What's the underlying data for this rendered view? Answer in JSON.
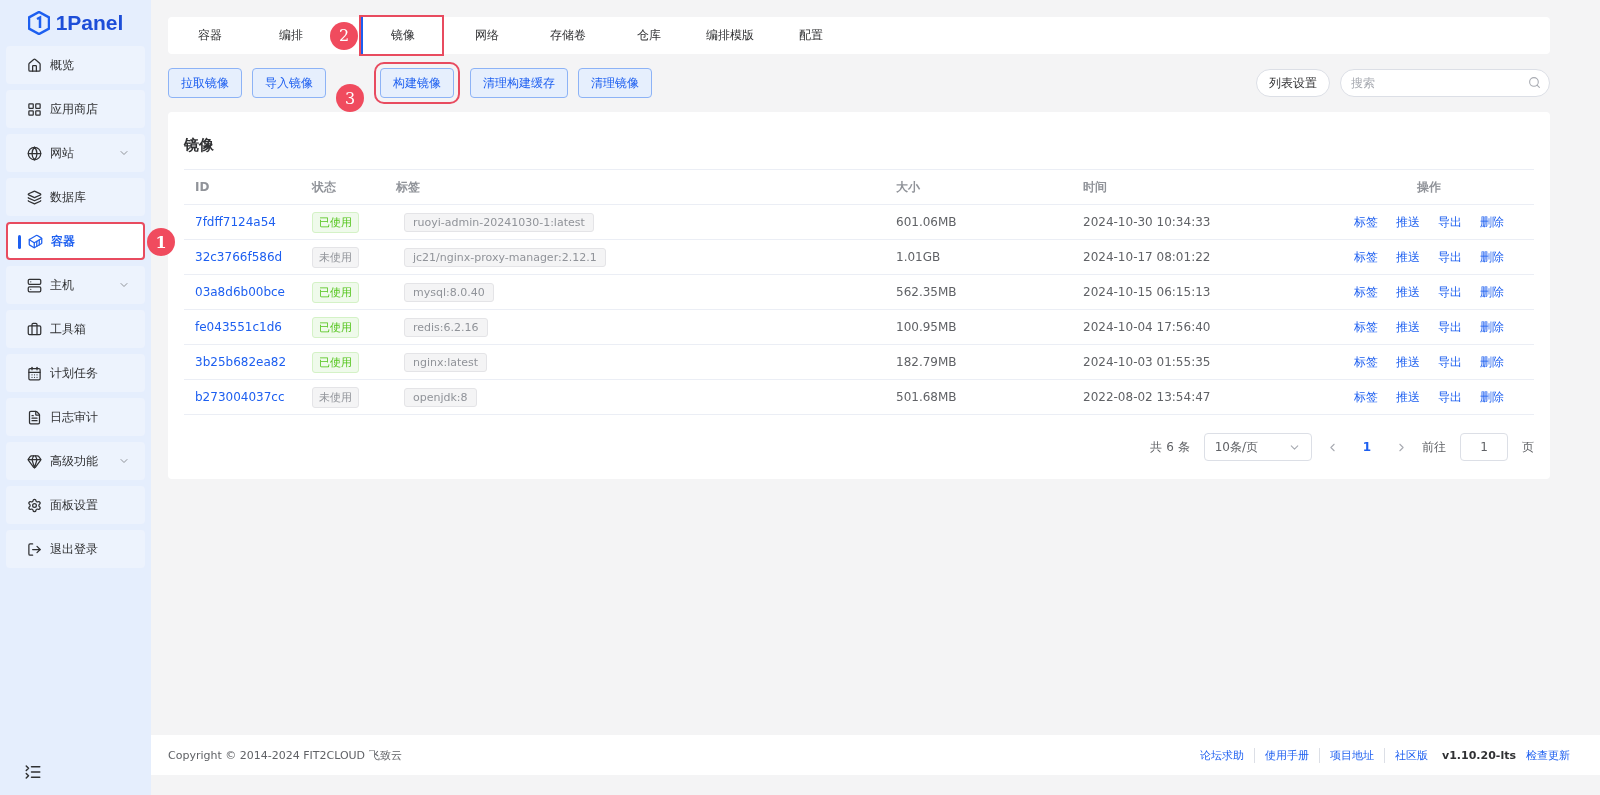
{
  "logo": "1Panel",
  "sidebar": {
    "items": [
      {
        "label": "概览",
        "selected": false,
        "expandable": false
      },
      {
        "label": "应用商店",
        "selected": false,
        "expandable": false
      },
      {
        "label": "网站",
        "selected": false,
        "expandable": true
      },
      {
        "label": "数据库",
        "selected": false,
        "expandable": false
      },
      {
        "label": "容器",
        "selected": true,
        "expandable": false,
        "annotation": "1"
      },
      {
        "label": "主机",
        "selected": false,
        "expandable": true
      },
      {
        "label": "工具箱",
        "selected": false,
        "expandable": false
      },
      {
        "label": "计划任务",
        "selected": false,
        "expandable": false
      },
      {
        "label": "日志审计",
        "selected": false,
        "expandable": false
      },
      {
        "label": "高级功能",
        "selected": false,
        "expandable": true
      },
      {
        "label": "面板设置",
        "selected": false,
        "expandable": false
      },
      {
        "label": "退出登录",
        "selected": false,
        "expandable": false
      }
    ]
  },
  "tabs": [
    {
      "label": "容器",
      "selected": false
    },
    {
      "label": "编排",
      "selected": false
    },
    {
      "label": "镜像",
      "selected": true,
      "annotation": "2"
    },
    {
      "label": "网络",
      "selected": false
    },
    {
      "label": "存储卷",
      "selected": false
    },
    {
      "label": "仓库",
      "selected": false
    },
    {
      "label": "编排模版",
      "selected": false
    },
    {
      "label": "配置",
      "selected": false
    }
  ],
  "toolbar": {
    "buttons": [
      {
        "label": "拉取镜像"
      },
      {
        "label": "导入镜像"
      },
      {
        "label": "构建镜像",
        "annotation": "3"
      },
      {
        "label": "清理构建缓存"
      },
      {
        "label": "清理镜像"
      }
    ],
    "list_settings": "列表设置",
    "search": {
      "placeholder": "搜索"
    }
  },
  "card": {
    "title": "镜像",
    "table": {
      "columns": [
        "ID",
        "状态",
        "标签",
        "大小",
        "时间",
        "操作"
      ],
      "rows": [
        {
          "id": "7fdff7124a54",
          "status": {
            "text": "已使用",
            "kind": "used"
          },
          "tag": "ruoyi-admin-20241030-1:latest",
          "size": "601.06MB",
          "time": "2024-10-30 10:34:33",
          "actions": [
            "标签",
            "推送",
            "导出",
            "删除"
          ]
        },
        {
          "id": "32c3766f586d",
          "status": {
            "text": "未使用",
            "kind": "unused"
          },
          "tag": "jc21/nginx-proxy-manager:2.12.1",
          "size": "1.01GB",
          "time": "2024-10-17 08:01:22",
          "actions": [
            "标签",
            "推送",
            "导出",
            "删除"
          ]
        },
        {
          "id": "03a8d6b00bce",
          "status": {
            "text": "已使用",
            "kind": "used"
          },
          "tag": "mysql:8.0.40",
          "size": "562.35MB",
          "time": "2024-10-15 06:15:13",
          "actions": [
            "标签",
            "推送",
            "导出",
            "删除"
          ]
        },
        {
          "id": "fe043551c1d6",
          "status": {
            "text": "已使用",
            "kind": "used"
          },
          "tag": "redis:6.2.16",
          "size": "100.95MB",
          "time": "2024-10-04 17:56:40",
          "actions": [
            "标签",
            "推送",
            "导出",
            "删除"
          ]
        },
        {
          "id": "3b25b682ea82",
          "status": {
            "text": "已使用",
            "kind": "used"
          },
          "tag": "nginx:latest",
          "size": "182.79MB",
          "time": "2024-10-03 01:55:35",
          "actions": [
            "标签",
            "推送",
            "导出",
            "删除"
          ]
        },
        {
          "id": "b273004037cc",
          "status": {
            "text": "未使用",
            "kind": "unused"
          },
          "tag": "openjdk:8",
          "size": "501.68MB",
          "time": "2022-08-02 13:54:47",
          "actions": [
            "标签",
            "推送",
            "导出",
            "删除"
          ]
        }
      ]
    },
    "pagination": {
      "total": "共 6 条",
      "page_size": "10条/页",
      "pages": [
        {
          "label": "1",
          "selected": true
        }
      ],
      "goto_label": "前往",
      "goto_value": "1",
      "goto_suffix": "页"
    }
  },
  "footer": {
    "copyright": "Copyright © 2014-2024 FIT2CLOUD 飞致云",
    "links": [
      "论坛求助",
      "使用手册",
      "项目地址",
      "社区版"
    ],
    "version": "v1.10.20-lts",
    "update_link": "检查更新"
  }
}
